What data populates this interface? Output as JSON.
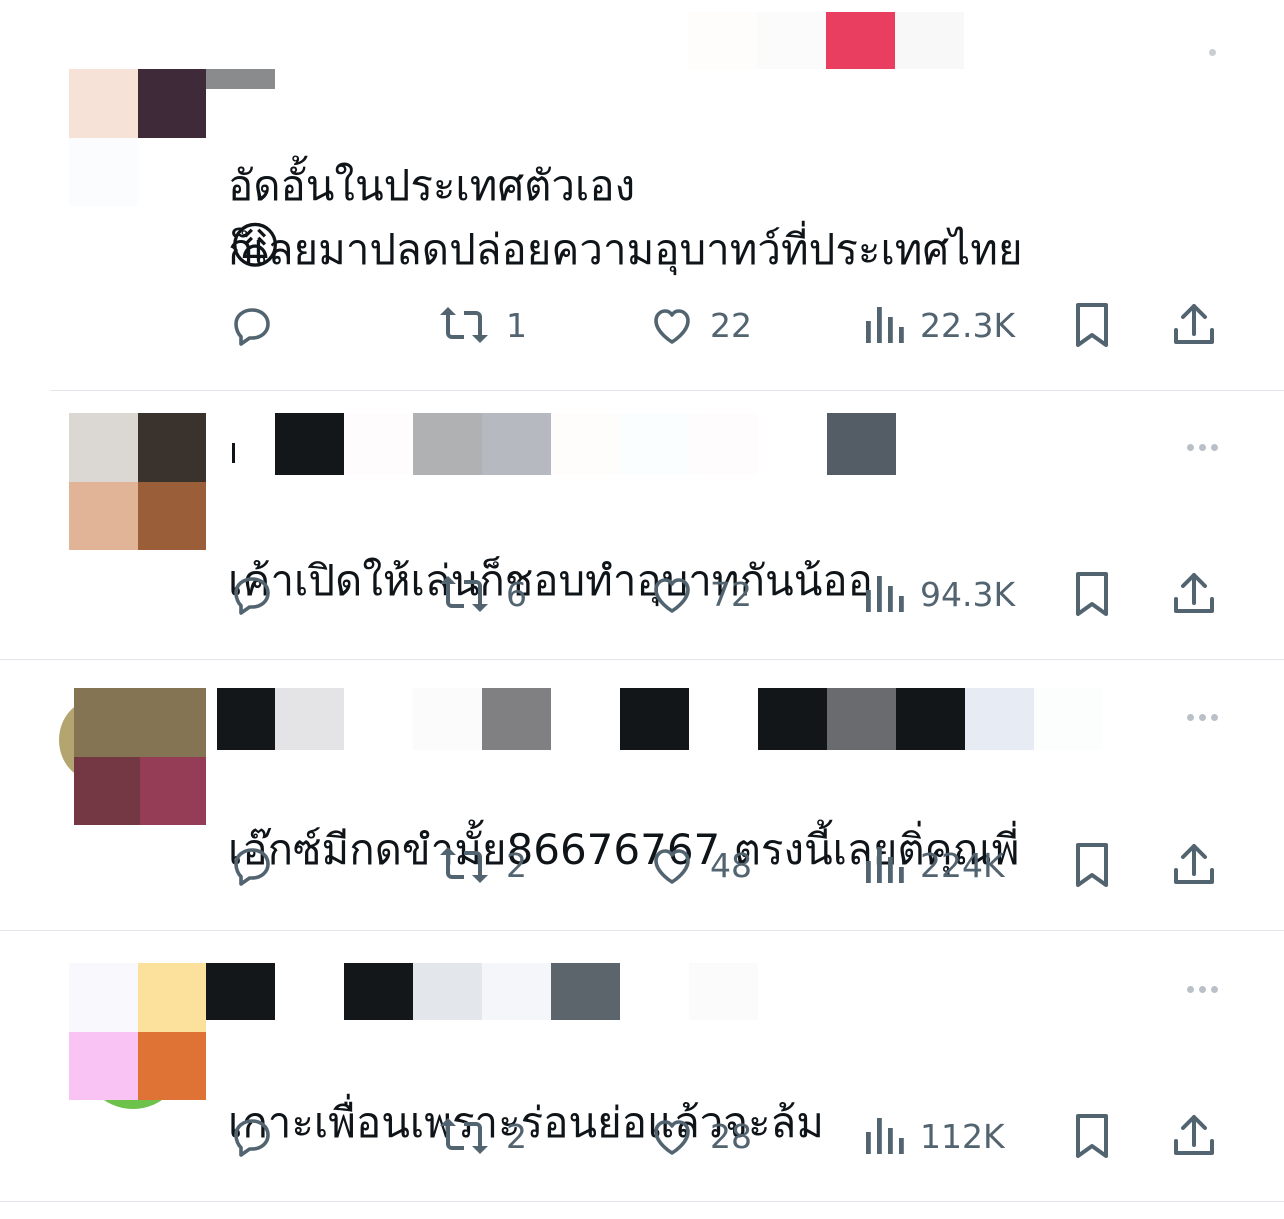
{
  "posts": [
    {
      "text": "อัดอั้นในประเทศตัวเอง\nก็เลยมาปลดปล่อยความอุบาทว์ที่ประเทศไทย",
      "emoji": "😩",
      "reply_count": "",
      "repost_count": "1",
      "like_count": "22",
      "view_count": "22.3K"
    },
    {
      "text": "เค้าเปิดให้เล่นก็ชอบทำอุบาทกันน้ออ",
      "reply_count": "",
      "repost_count": "6",
      "like_count": "72",
      "view_count": "94.3K"
    },
    {
      "text": "เอ๊กซ์มีกดขำมั้ย86676767 ตรงนี้เลยติ่คุณพี่",
      "reply_count": "",
      "repost_count": "2",
      "like_count": "48",
      "view_count": "224K"
    },
    {
      "text": "เกาะเพื่อนเพราะร่อนย่อแล้วจะล้ม",
      "reply_count": "",
      "repost_count": "2",
      "like_count": "28",
      "view_count": "112K"
    }
  ],
  "icons": {
    "reply": "speech-bubble-icon",
    "repost": "repost-arrows-icon",
    "like": "heart-icon",
    "views": "bar-chart-icon",
    "bookmark": "bookmark-icon",
    "share": "share-upload-icon",
    "more": "more-dots-icon"
  },
  "colors": {
    "icon_gray": "#536471",
    "text": "#0f1419",
    "divider": "#e3e6ea"
  }
}
